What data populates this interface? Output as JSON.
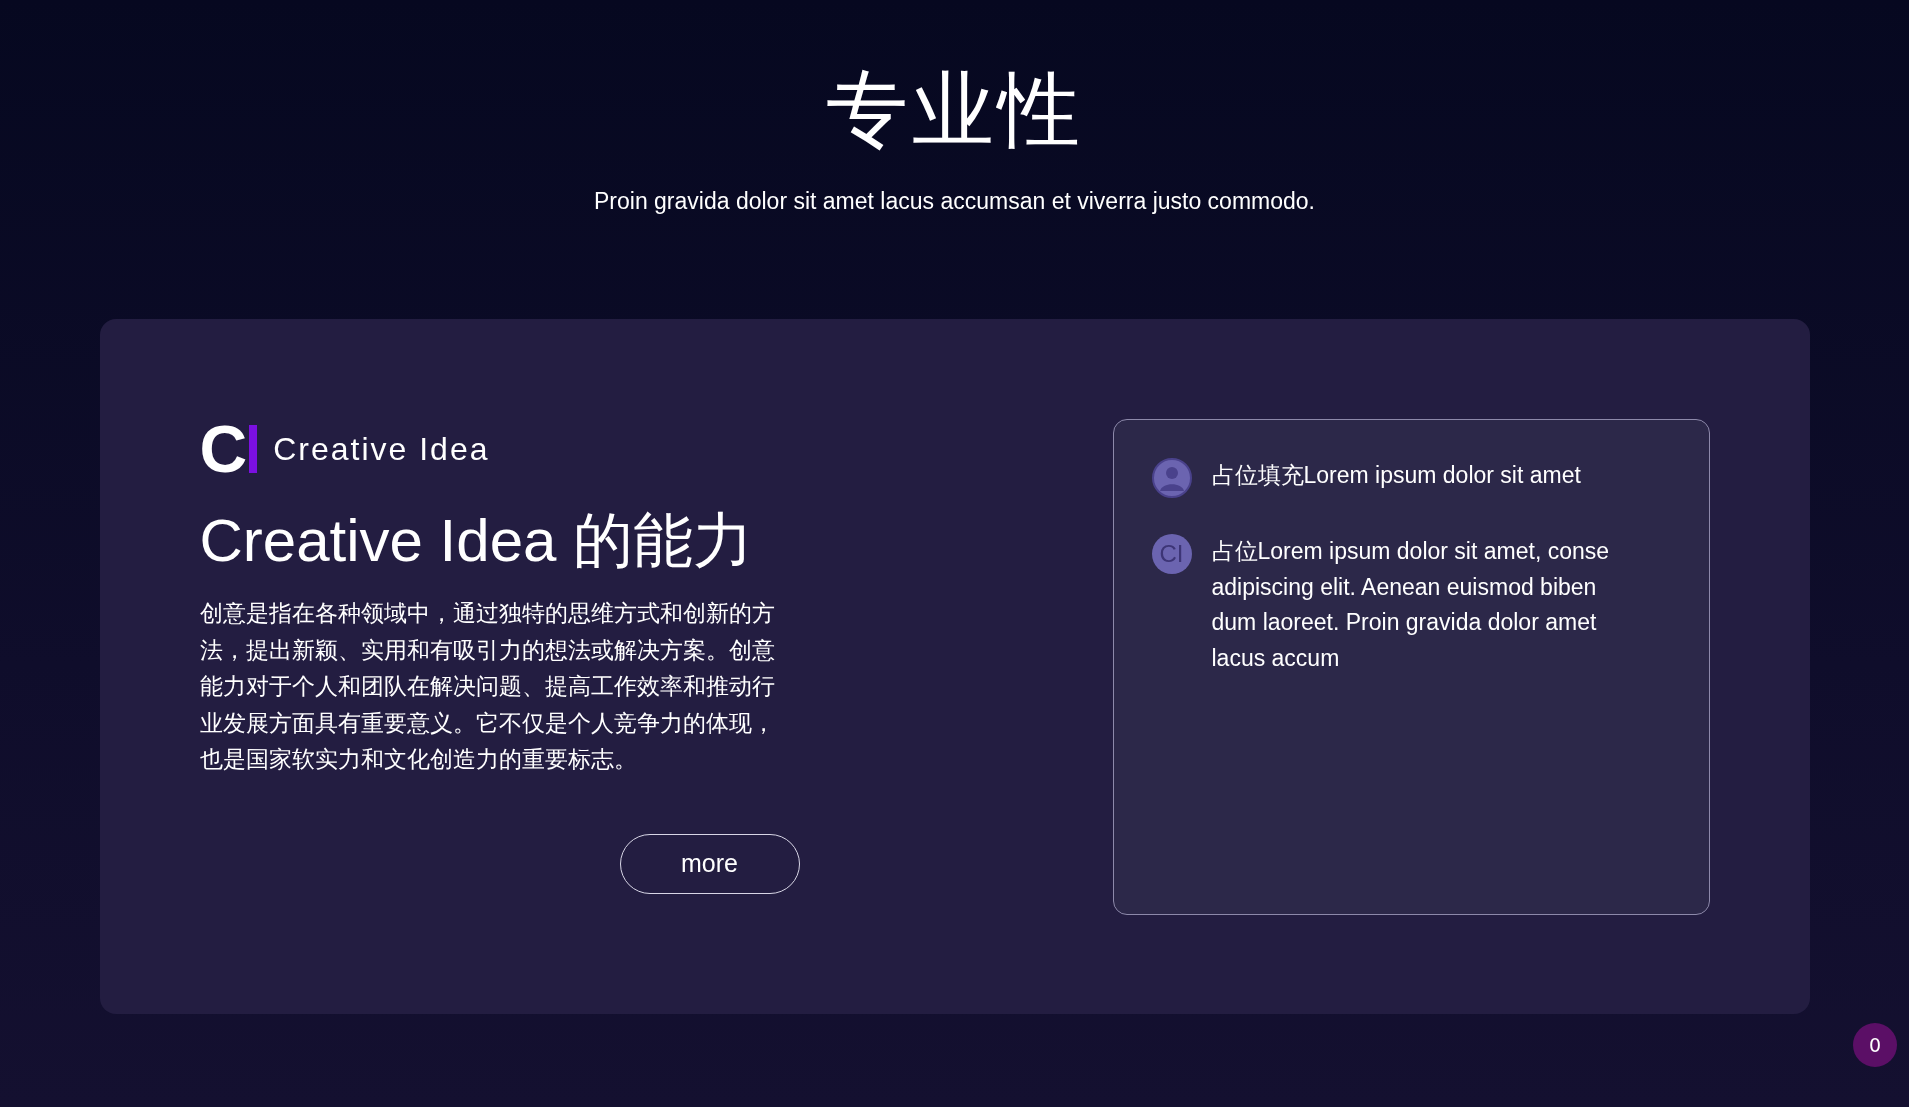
{
  "header": {
    "title": "专业性",
    "subtitle": "Proin gravida dolor sit amet lacus accumsan et viverra justo commodo."
  },
  "card": {
    "logo": {
      "mark": "C",
      "name": "Creative Idea"
    },
    "heading": "Creative Idea 的能力",
    "body_lines": [
      "创意是指在各种领域中，通过独特的思维方式和创新的方",
      "法，提出新颖、实用和有吸引力的想法或解决方案。创意",
      "能力对于个人和团队在解决问题、提高工作效率和推动行",
      "业发展方面具有重要意义。它不仅是个人竞争力的体现，",
      "也是国家软实力和文化创造力的重要标志。"
    ],
    "button": "more",
    "chat": [
      {
        "kind": "user",
        "lines": [
          "占位填充Lorem ipsum dolor sit amet"
        ]
      },
      {
        "kind": "bot",
        "avatar": "CI",
        "lines": [
          "占位Lorem ipsum dolor sit amet, conse",
          "adipiscing elit. Aenean euismod biben",
          "dum laoreet. Proin gravida dolor amet",
          "lacus accum"
        ]
      }
    ]
  },
  "badge": "0"
}
